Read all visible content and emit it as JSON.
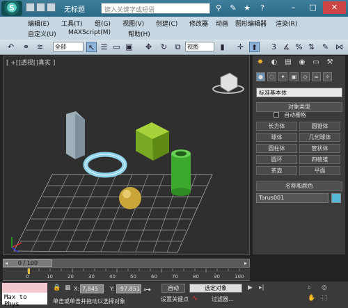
{
  "window": {
    "title": "无标题",
    "search_placeholder": "键入关键字或短语"
  },
  "menu": [
    {
      "label": "编辑(E)"
    },
    {
      "label": "工具(T)"
    },
    {
      "label": "组(G)"
    },
    {
      "label": "视图(V)"
    },
    {
      "label": "创建(C)"
    },
    {
      "label": "修改器"
    },
    {
      "label": "动画"
    },
    {
      "label": "图形编辑器"
    },
    {
      "label": "渲染(R)"
    },
    {
      "label": "自定义(U)"
    },
    {
      "label": "MAXScript(M)"
    },
    {
      "label": "帮助(H)"
    }
  ],
  "toolbar": {
    "selection_filter": "全部",
    "reference_coord": "视图"
  },
  "viewport": {
    "label": "[ +[]透视[]真实 ]"
  },
  "panel": {
    "category_dropdown": "标准基本体",
    "object_type_header": "对象类型",
    "auto_grid_label": "自动栅格",
    "buttons": [
      {
        "label": "长方体"
      },
      {
        "label": "圆锥体"
      },
      {
        "label": "球体"
      },
      {
        "label": "几何球体"
      },
      {
        "label": "圆柱体"
      },
      {
        "label": "管状体"
      },
      {
        "label": "圆环"
      },
      {
        "label": "四棱锥"
      },
      {
        "label": "茶壶"
      },
      {
        "label": "平面"
      }
    ],
    "name_color_header": "名称和颜色",
    "object_name": "Torus001",
    "object_color": "#57b8d6"
  },
  "timeline": {
    "frame_display": "0 / 100",
    "ticks": [
      "0",
      "10",
      "20",
      "30",
      "40",
      "50",
      "60",
      "70",
      "80",
      "90",
      "100"
    ]
  },
  "status": {
    "maxscript_text": "Max to Phys",
    "x_label": "X:",
    "x_value": "7.845",
    "y_label": "Y:",
    "y_value": "-97.851",
    "auto_key_label": "自动",
    "set_key_label": "设置关键点",
    "selected_object": "选定对象",
    "filters_label": "过滤器...",
    "prompt": "单击或单击并拖动以选择对象"
  }
}
